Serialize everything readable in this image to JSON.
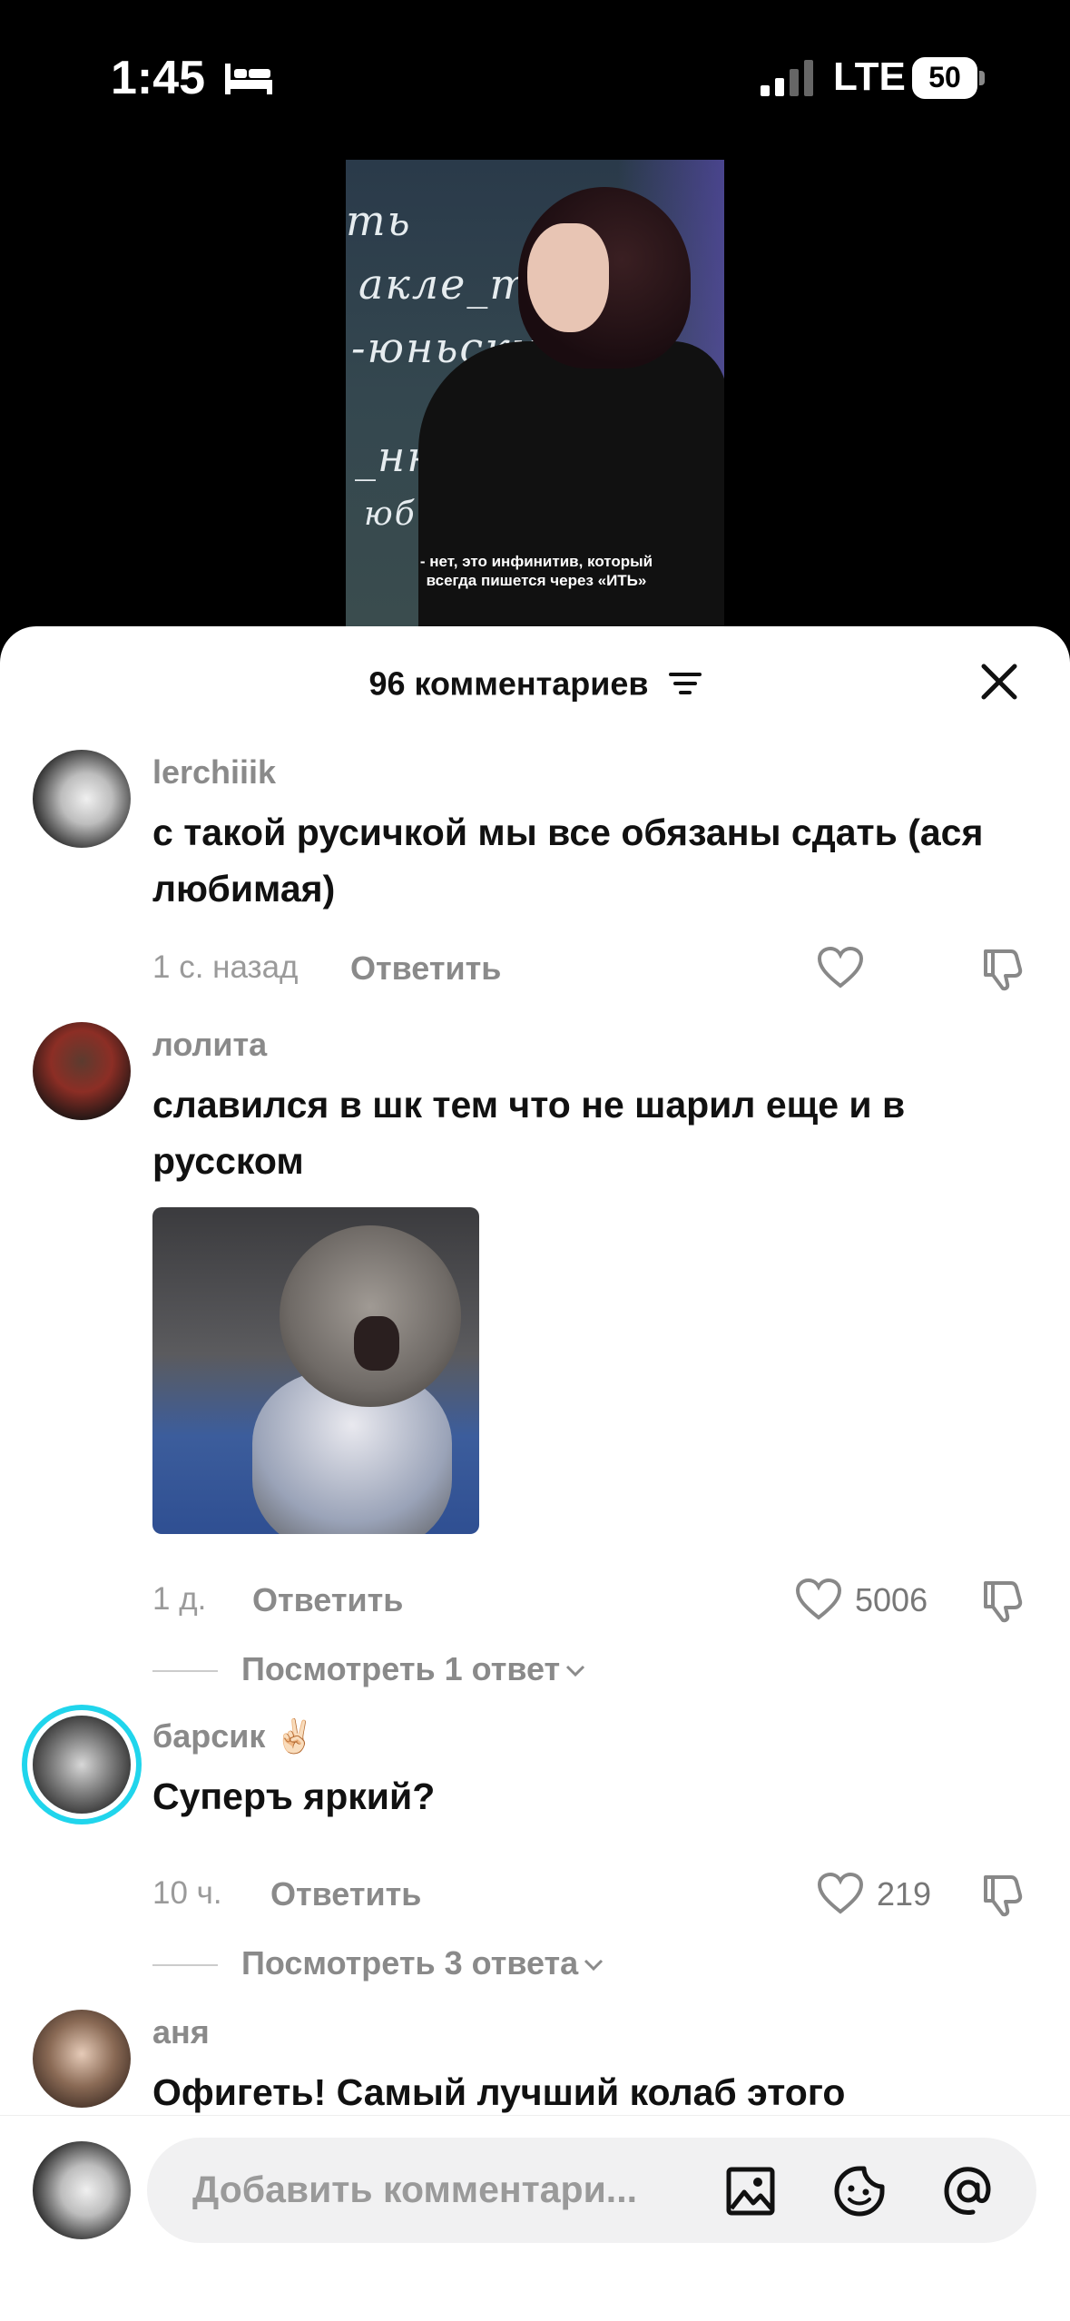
{
  "status_bar": {
    "time": "1:45",
    "network": "LTE",
    "battery": "50"
  },
  "video": {
    "board_lines": [
      "ть",
      "акле_т",
      "-юньский",
      "",
      "_нные",
      "юбки)"
    ],
    "caption_line1": "- нет, это инфинитив, который",
    "caption_line2": "всегда пишется через «ИТЬ»"
  },
  "sheet": {
    "title": "96 комментариев"
  },
  "comments": [
    {
      "username": "lerchiiik",
      "text": "с такой русичкой мы все обязаны сдать (ася любимая)",
      "time": "1 с. назад",
      "reply_label": "Ответить",
      "likes": ""
    },
    {
      "username": "лолита",
      "text": "славился в шк тем что не шарил еще и в русском",
      "time": "1 д.",
      "reply_label": "Ответить",
      "likes": "5006",
      "view_replies": "Посмотреть 1 ответ"
    },
    {
      "username": "барсик ✌🏻",
      "text": "Суперъ яркий?",
      "time": "10 ч.",
      "reply_label": "Ответить",
      "likes": "219",
      "view_replies": "Посмотреть 3 ответа"
    },
    {
      "username": "аня",
      "text": "Офигеть! Самый лучший колаб этого"
    }
  ],
  "composer": {
    "placeholder": "Добавить комментари..."
  },
  "colors": {
    "accent_ring": "#20d5ec",
    "muted_text": "#8a8a8a"
  }
}
